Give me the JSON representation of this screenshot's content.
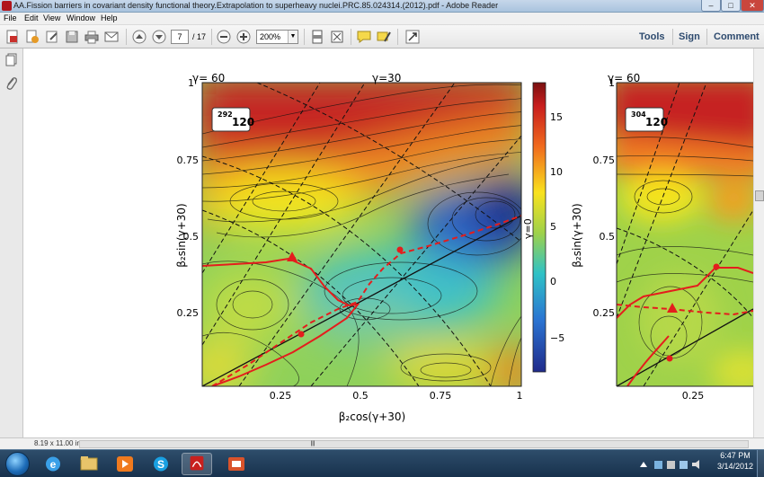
{
  "window": {
    "title": "AA.Fission barriers in covariant density functional theory.Extrapolation to superheavy nuclei.PRC.85.024314.(2012).pdf - Adobe Reader",
    "minimize": "–",
    "maximize": "□",
    "close": "✕"
  },
  "menu": [
    "File",
    "Edit",
    "View",
    "Window",
    "Help"
  ],
  "toolbar": {
    "page_current": "7",
    "page_total": "/ 17",
    "zoom": "200%",
    "tools_label": "Tools",
    "sign_label": "Sign",
    "comment_label": "Comment"
  },
  "status": {
    "page_size": "8.19 x 11.00 in"
  },
  "taskbar": {
    "time": "6:47 PM",
    "date": "3/14/2012"
  },
  "figures": {
    "left": {
      "nucleus_mass": "292",
      "nucleus_z": "120",
      "gamma60": "γ= 60",
      "gamma30": "γ=30",
      "gamma0": "γ=0",
      "ylabel": "β₂sin(γ+30)",
      "xlabel": "β₂cos(γ+30)",
      "yticks": [
        "1",
        "0.75",
        "0.5",
        "0.25"
      ],
      "xticks": [
        "0.25",
        "0.5",
        "0.75",
        "1"
      ],
      "colorbar_ticks": [
        "15",
        "10",
        "5",
        "0",
        "−5"
      ]
    },
    "right": {
      "nucleus_mass": "304",
      "nucleus_z": "120",
      "gamma60": "γ= 60",
      "ylabel": "β₂sin(γ+30)",
      "yticks": [
        "1",
        "0.75",
        "0.5",
        "0.25"
      ],
      "xticks": [
        "0.25"
      ]
    }
  },
  "chart_data": [
    {
      "type": "heatmap",
      "title": "292 120",
      "xlabel": "β2cos(γ+30)",
      "ylabel": "β2sin(γ+30)",
      "xlim": [
        0,
        1
      ],
      "ylim": [
        0,
        1
      ],
      "x_ticks": [
        0.25,
        0.5,
        0.75,
        1
      ],
      "y_ticks": [
        0.25,
        0.5,
        0.75,
        1
      ],
      "colorbar": {
        "range": [
          -8,
          18
        ],
        "ticks": [
          15,
          10,
          5,
          0,
          -5
        ]
      },
      "annotations": [
        "γ= 60",
        "γ=30",
        "γ=0"
      ],
      "paths": [
        {
          "name": "solid",
          "color": "#e02020",
          "points": [
            [
              0,
              0.38
            ],
            [
              0.07,
              0.37
            ],
            [
              0.14,
              0.38
            ],
            [
              0.21,
              0.4
            ],
            [
              0.27,
              0.42
            ],
            [
              0.32,
              0.38
            ],
            [
              0.37,
              0.32
            ],
            [
              0.42,
              0.29
            ],
            [
              0.47,
              0.27
            ]
          ]
        },
        {
          "name": "dashed",
          "color": "#e02020",
          "points": [
            [
              0,
              0.02
            ],
            [
              0.06,
              0.06
            ],
            [
              0.13,
              0.11
            ],
            [
              0.2,
              0.16
            ],
            [
              0.27,
              0.2
            ],
            [
              0.32,
              0.22
            ],
            [
              0.37,
              0.25
            ],
            [
              0.42,
              0.28
            ],
            [
              0.47,
              0.34
            ],
            [
              0.51,
              0.4
            ],
            [
              0.56,
              0.43
            ],
            [
              0.62,
              0.45
            ],
            [
              0.7,
              0.47
            ],
            [
              0.8,
              0.5
            ],
            [
              0.9,
              0.53
            ],
            [
              0.97,
              0.55
            ]
          ]
        }
      ],
      "markers": [
        {
          "shape": "triangle",
          "x": 0.29,
          "y": 0.42
        },
        {
          "shape": "circle",
          "x": 0.32,
          "y": 0.17
        },
        {
          "shape": "circle",
          "x": 0.62,
          "y": 0.45
        }
      ]
    },
    {
      "type": "heatmap",
      "title": "304 120",
      "ylabel": "β2sin(γ+30)",
      "xlim": [
        0,
        0.43
      ],
      "ylim": [
        0,
        1
      ],
      "x_ticks": [
        0.25
      ],
      "y_ticks": [
        0.25,
        0.5,
        0.75,
        1
      ],
      "annotations": [
        "γ= 60"
      ],
      "markers": [
        {
          "shape": "triangle",
          "x": 0.18,
          "y": 0.27
        },
        {
          "shape": "circle",
          "x": 0.3,
          "y": 0.41
        },
        {
          "shape": "circle",
          "x": 0.17,
          "y": 0.09
        }
      ]
    }
  ]
}
